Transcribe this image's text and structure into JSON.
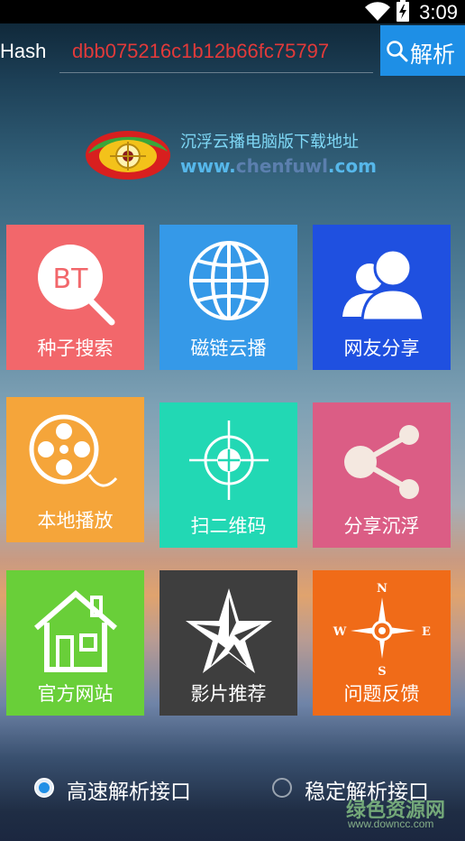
{
  "status_bar": {
    "time": "3:09"
  },
  "header": {
    "hash_label": "Hash",
    "hash_value": "dbb075216c1b12b66fc75797",
    "parse_button_label": "解析"
  },
  "logo": {
    "line1": "沉浮云播电脑版下载地址",
    "url_prefix": "www.",
    "url_mid": "chenfuwl",
    "url_suffix": ".com"
  },
  "tiles": [
    {
      "label": "种子搜索",
      "icon": "bt-search-icon",
      "color": "#f2676b",
      "icon_text": "BT"
    },
    {
      "label": "磁链云播",
      "icon": "globe-icon",
      "color": "#3599e8"
    },
    {
      "label": "网友分享",
      "icon": "users-icon",
      "color": "#1f50e0"
    },
    {
      "label": "本地播放",
      "icon": "film-reel-icon",
      "color": "#f5a53a"
    },
    {
      "label": "扫二维码",
      "icon": "crosshair-icon",
      "color": "#22d8b4"
    },
    {
      "label": "分享沉浮",
      "icon": "share-icon",
      "color": "#db5d85"
    },
    {
      "label": "官方网站",
      "icon": "house-icon",
      "color": "#69cf39"
    },
    {
      "label": "影片推荐",
      "icon": "star-icon",
      "color": "#3e3e3e"
    },
    {
      "label": "问题反馈",
      "icon": "compass-icon",
      "color": "#f06b18",
      "compass": {
        "n": "N",
        "s": "S",
        "e": "E",
        "w": "W"
      }
    }
  ],
  "options": {
    "fast": {
      "label": "高速解析接口",
      "selected": true
    },
    "stable": {
      "label": "稳定解析接口",
      "selected": false
    }
  },
  "watermark": {
    "cn": "绿色资源网",
    "url": "www.downcc.com"
  }
}
